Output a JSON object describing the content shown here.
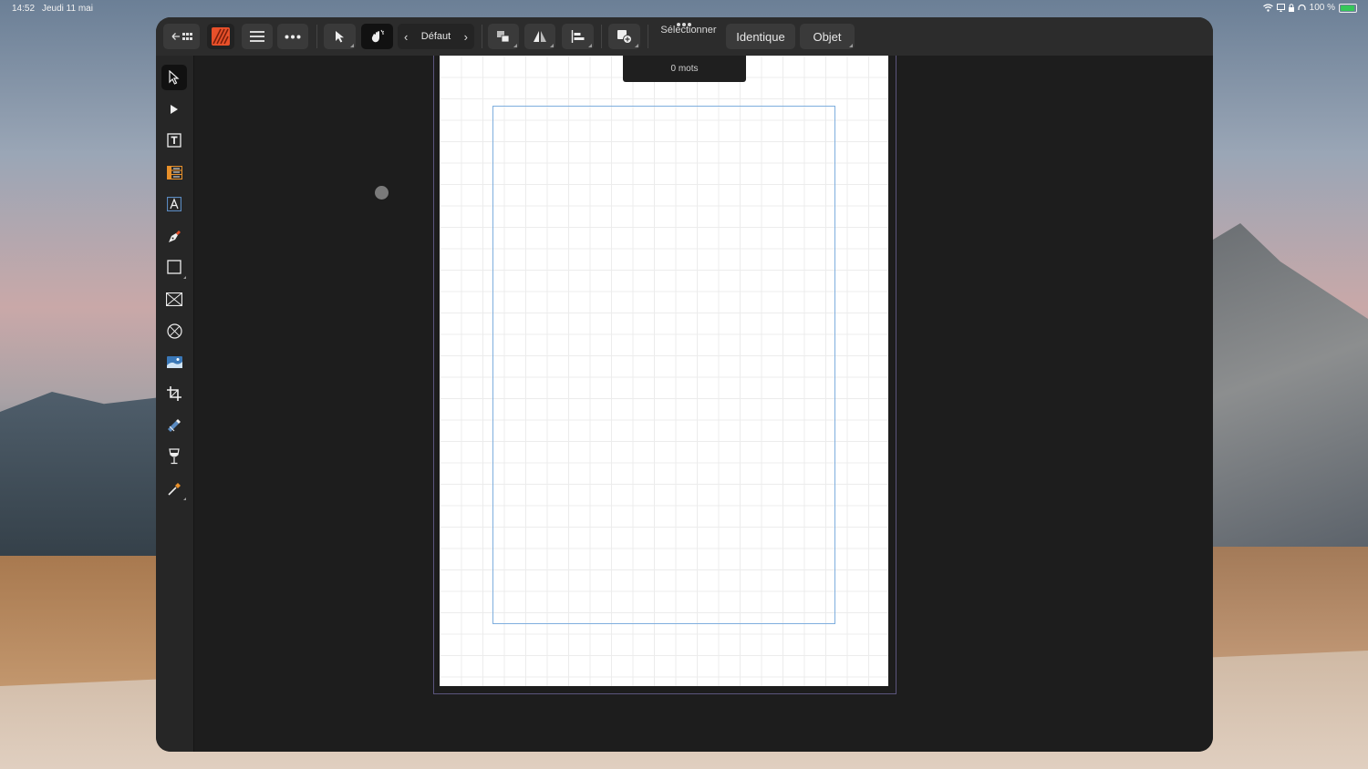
{
  "status_bar": {
    "time": "14:52",
    "date": "Jeudi 11 mai",
    "battery": "100 %",
    "battery_level": 0.86
  },
  "toolbar": {
    "default_label": "Défaut",
    "select_label": "Sélectionner",
    "same_label": "Identique",
    "object_label": "Objet"
  },
  "document": {
    "word_count": "0 mots"
  },
  "colors": {
    "app_bg": "#1d1d1d",
    "toolbar": "#2c2c2c",
    "margin_guide": "#7eaede",
    "app_icon": "#e8502a"
  },
  "tools": [
    "move-tool",
    "node-tool",
    "text-frame-tool",
    "table-tool",
    "artistic-text-tool",
    "pen-tool",
    "rectangle-tool",
    "picture-frame-rect-tool",
    "picture-frame-ellipse-tool",
    "place-image-tool",
    "crop-tool",
    "fill-tool",
    "transparency-tool",
    "color-picker-tool"
  ]
}
